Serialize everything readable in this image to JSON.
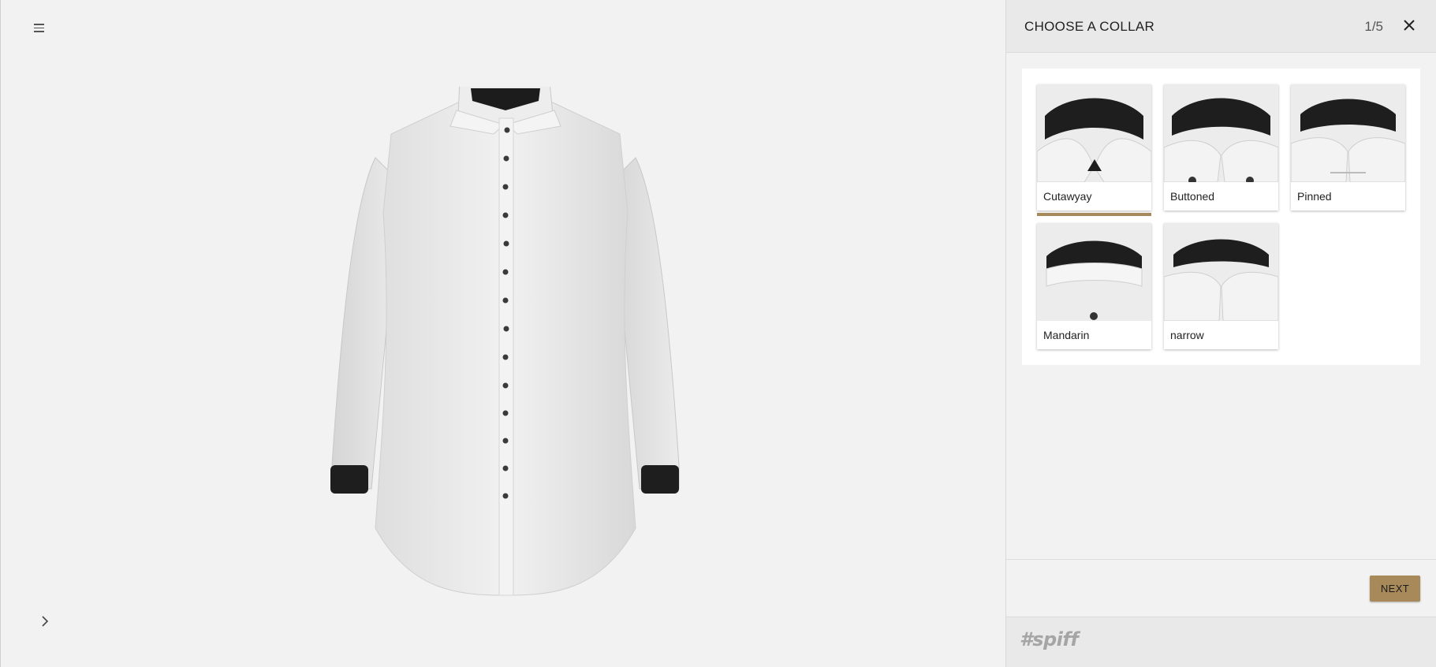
{
  "panel": {
    "title": "CHOOSE A COLLAR",
    "step": "1/5",
    "next_label": "NEXT",
    "options": [
      {
        "label": "Cutawyay",
        "selected": true
      },
      {
        "label": "Buttoned",
        "selected": false
      },
      {
        "label": "Pinned",
        "selected": false
      },
      {
        "label": "Mandarin",
        "selected": false
      },
      {
        "label": "narrow",
        "selected": false
      }
    ]
  },
  "brand": {
    "logo_text": "#spiff"
  },
  "icons": {
    "menu": "hamburger-menu-icon",
    "expand": "chevron-right-icon",
    "close": "close-icon"
  },
  "colors": {
    "accent": "#a8895a",
    "background": "#f2f2f2",
    "panel_header": "#e9e9e9"
  }
}
